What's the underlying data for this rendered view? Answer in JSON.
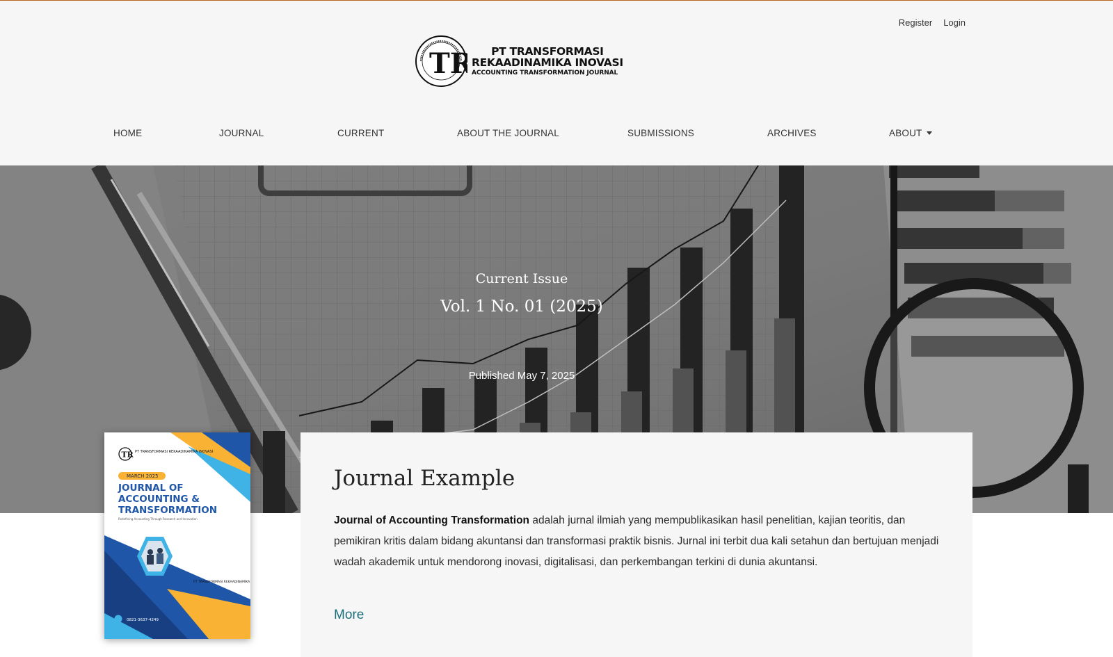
{
  "user_nav": {
    "register": "Register",
    "login": "Login"
  },
  "logo": {
    "line1": "PT TRANSFORMASI",
    "line2": "REKAADINAMIKA INOVASI",
    "line3": "ACCOUNTING TRANSFORMATION JOURNAL",
    "monogram": "TR"
  },
  "nav": {
    "items": [
      {
        "label": "HOME"
      },
      {
        "label": "JOURNAL"
      },
      {
        "label": "CURRENT"
      },
      {
        "label": "ABOUT THE JOURNAL"
      },
      {
        "label": "SUBMISSIONS"
      },
      {
        "label": "ARCHIVES"
      },
      {
        "label": "ABOUT"
      }
    ]
  },
  "hero": {
    "label": "Current Issue",
    "issue": "Vol. 1 No. 01 (2025)",
    "published": "Published May 7, 2025"
  },
  "cover": {
    "publisher": "PT TRANSFORMASI REKAADINAMIKA INOVASI",
    "badge": "MARCH 2025",
    "title_l1": "JOURNAL OF",
    "title_l2": "ACCOUNTING &",
    "title_l3": "TRANSFORMATION",
    "tagline": "Redefining Accounting Through Research and Innovation",
    "phone": "0821-3637-4249"
  },
  "about": {
    "title": "Journal Example",
    "journal_name": "Journal of Accounting Transformation",
    "description": " adalah jurnal ilmiah yang mempublikasikan hasil penelitian, kajian teoritis, dan pemikiran kritis dalam bidang akuntansi dan transformasi praktik bisnis. Jurnal ini terbit dua kali setahun dan bertujuan menjadi wadah akademik untuk mendorong inovasi, digitalisasi, dan perkembangan terkini di dunia akuntansi.",
    "more": "More"
  },
  "colors": {
    "accent_rule": "#b5651d",
    "link": "#1b6f7a",
    "cover_blue": "#1f56a8",
    "cover_orange": "#f9b233"
  }
}
